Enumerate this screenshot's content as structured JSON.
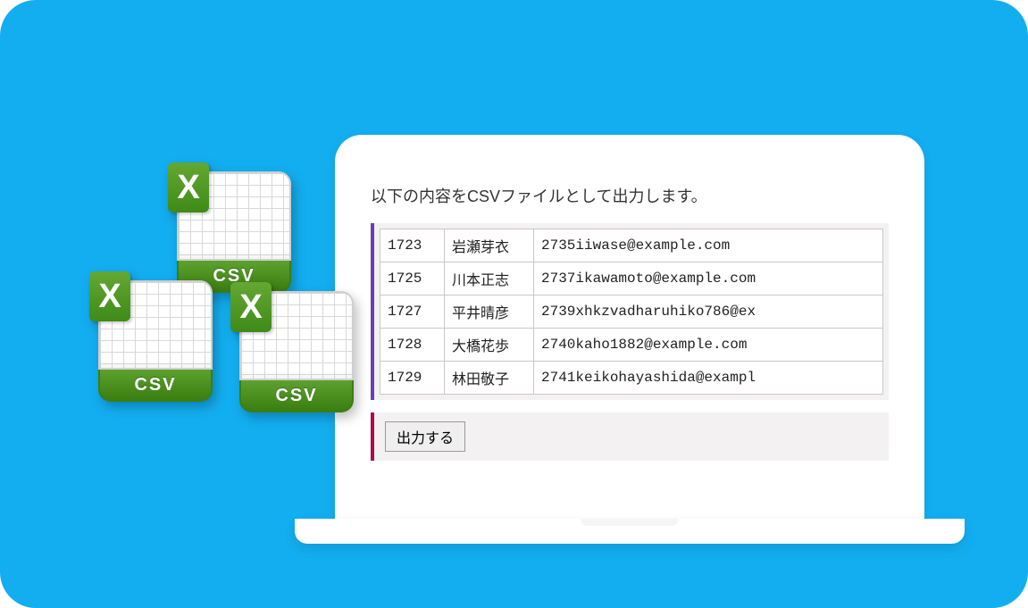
{
  "instruction": "以下の内容をCSVファイルとして出力します。",
  "table": {
    "rows": [
      {
        "id": "1723",
        "name": "岩瀬芽衣",
        "email": "2735iiwase@example.com"
      },
      {
        "id": "1725",
        "name": "川本正志",
        "email": "2737ikawamoto@example.com"
      },
      {
        "id": "1727",
        "name": "平井晴彦",
        "email": "2739xhkzvadharuhiko786@ex"
      },
      {
        "id": "1728",
        "name": "大橋花歩",
        "email": "2740kaho1882@example.com"
      },
      {
        "id": "1729",
        "name": "林田敬子",
        "email": "2741keikohayashida@exampl"
      }
    ]
  },
  "exportButton": "出力する",
  "csvIcon": {
    "bandLabel": "CSV",
    "badgeLetter": "X"
  }
}
